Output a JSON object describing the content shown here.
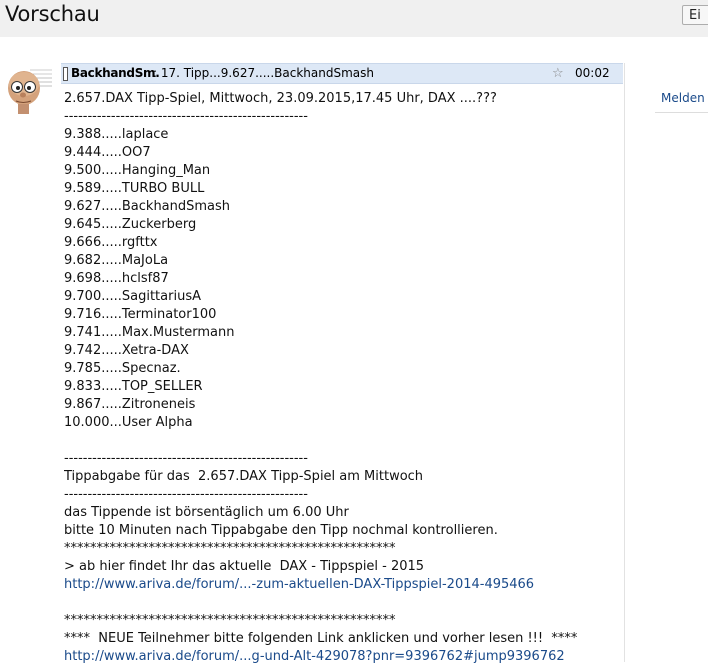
{
  "page": {
    "title": "Vorschau",
    "top_button": "Ei"
  },
  "post": {
    "author": "BackhandSm.",
    "subject": ": 17. Tipp...9.627.....BackhandSmash",
    "time": "00:02",
    "report_label": "Melden",
    "lines": [
      {
        "text": "2.657.DAX Tipp-Spiel, Mittwoch, 23.09.2015,17.45 Uhr, DAX ....???",
        "type": "text"
      },
      {
        "text": "----------------------------------------------------",
        "type": "text"
      },
      {
        "text": "9.388.....laplace",
        "type": "text"
      },
      {
        "text": "9.444.....OO7",
        "type": "text"
      },
      {
        "text": "9.500.....Hanging_Man",
        "type": "text"
      },
      {
        "text": "9.589.....TURBO BULL",
        "type": "text"
      },
      {
        "text": "9.627.....BackhandSmash",
        "type": "text"
      },
      {
        "text": "9.645.....Zuckerberg",
        "type": "text"
      },
      {
        "text": "9.666.....rgfttx",
        "type": "text"
      },
      {
        "text": "9.682.....MaJoLa",
        "type": "text"
      },
      {
        "text": "9.698.....hclsf87",
        "type": "text"
      },
      {
        "text": "9.700.....SagittariusA",
        "type": "text"
      },
      {
        "text": "9.716.....Terminator100",
        "type": "text"
      },
      {
        "text": "9.741.....Max.Mustermann",
        "type": "text"
      },
      {
        "text": "9.742.....Xetra-DAX",
        "type": "text"
      },
      {
        "text": "9.785.....Specnaz.",
        "type": "text"
      },
      {
        "text": "9.833.....TOP_SELLER",
        "type": "text"
      },
      {
        "text": "9.867.....Zitroneneis",
        "type": "text"
      },
      {
        "text": "10.000...User Alpha",
        "type": "text"
      },
      {
        "text": "",
        "type": "text"
      },
      {
        "text": "----------------------------------------------------",
        "type": "text"
      },
      {
        "text": "Tippabgabe für das  2.657.DAX Tipp-Spiel am Mittwoch",
        "type": "text"
      },
      {
        "text": "----------------------------------------------------",
        "type": "text"
      },
      {
        "text": "das Tippende ist börsentäglich um 6.00 Uhr",
        "type": "text"
      },
      {
        "text": "bitte 10 Minuten nach Tippabgabe den Tipp nochmal kontrollieren.",
        "type": "text"
      },
      {
        "text": "***************************************************",
        "type": "text"
      },
      {
        "text": "> ab hier findet Ihr das aktuelle  DAX - Tippspiel - 2015",
        "type": "text"
      },
      {
        "text": "http://www.ariva.de/forum/...-zum-aktuellen-DAX-Tippspiel-2014-495466",
        "type": "link"
      },
      {
        "text": "",
        "type": "text"
      },
      {
        "text": "***************************************************",
        "type": "text"
      },
      {
        "text": "****  NEUE Teilnehmer bitte folgenden Link anklicken und vorher lesen !!!  ****",
        "type": "text"
      },
      {
        "text": "http://www.ariva.de/forum/...g-und-Alt-429078?pnr=9396762#jump9396762",
        "type": "link"
      }
    ]
  }
}
